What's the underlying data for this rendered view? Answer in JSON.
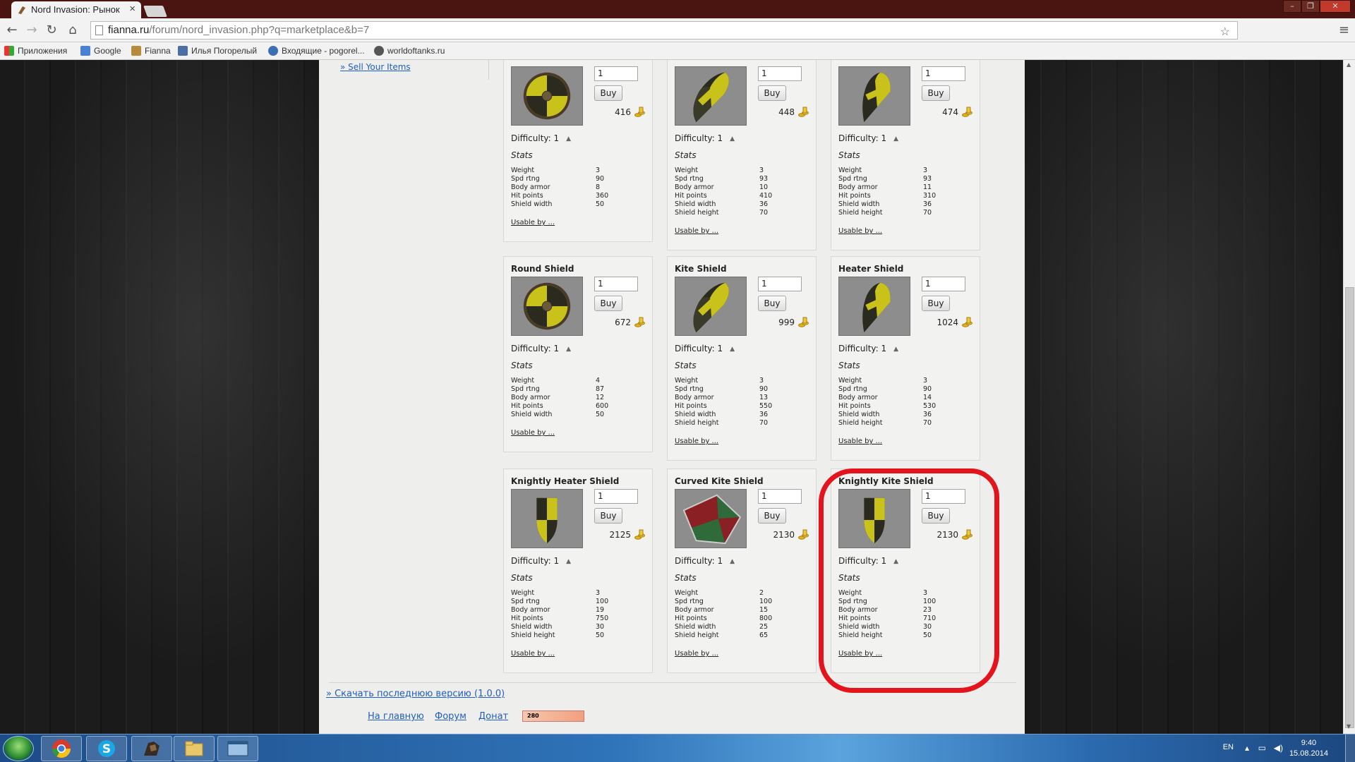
{
  "browser": {
    "tab_title": "Nord Invasion: Рынок",
    "tab_close": "×",
    "url_host": "fianna.ru",
    "url_path": "/forum/nord_invasion.php?q=marketplace&b=7",
    "bookmarks": [
      "Приложения",
      "Google",
      "Fianna",
      "Илья Погорелый",
      "Входящие - pogorel...",
      "worldoftanks.ru"
    ]
  },
  "sidebar": {
    "sell_link": "» Sell Your Items"
  },
  "labels": {
    "buy": "Buy",
    "difficulty": "Difficulty: 1",
    "stats": "Stats",
    "usable": "Usable by ...",
    "stat_names": [
      "Weight",
      "Spd rtng",
      "Body armor",
      "Hit points",
      "Shield width",
      "Shield height"
    ]
  },
  "items": [
    {
      "name": "",
      "qty": "1",
      "price": "416",
      "shape": "round",
      "stats": [
        "3",
        "90",
        "8",
        "360",
        "50"
      ]
    },
    {
      "name": "",
      "qty": "1",
      "price": "448",
      "shape": "kite",
      "stats": [
        "3",
        "93",
        "10",
        "410",
        "36",
        "70"
      ]
    },
    {
      "name": "",
      "qty": "1",
      "price": "474",
      "shape": "heater",
      "stats": [
        "3",
        "93",
        "11",
        "310",
        "36",
        "70"
      ]
    },
    {
      "name": "Round Shield",
      "qty": "1",
      "price": "672",
      "shape": "round",
      "stats": [
        "4",
        "87",
        "12",
        "600",
        "50"
      ]
    },
    {
      "name": "Kite Shield",
      "qty": "1",
      "price": "999",
      "shape": "kite",
      "stats": [
        "3",
        "90",
        "13",
        "550",
        "36",
        "70"
      ]
    },
    {
      "name": "Heater Shield",
      "qty": "1",
      "price": "1024",
      "shape": "heater",
      "stats": [
        "3",
        "90",
        "14",
        "530",
        "36",
        "70"
      ]
    },
    {
      "name": "Knightly Heater Shield",
      "qty": "1",
      "price": "2125",
      "shape": "knight",
      "stats": [
        "3",
        "100",
        "19",
        "750",
        "30",
        "50"
      ]
    },
    {
      "name": "Curved Kite Shield",
      "qty": "1",
      "price": "2130",
      "shape": "curved",
      "stats": [
        "2",
        "100",
        "15",
        "800",
        "25",
        "65"
      ]
    },
    {
      "name": "Knightly Kite Shield",
      "qty": "1",
      "price": "2130",
      "shape": "knight",
      "stats": [
        "3",
        "100",
        "23",
        "710",
        "30",
        "50"
      ]
    }
  ],
  "footer": {
    "download_link": "» Скачать последнюю версию (1.0.0)",
    "home": "На главную",
    "forum": "Форум",
    "donate": "Донат",
    "counter": "280"
  },
  "taskbar": {
    "lang": "EN",
    "time": "9:40",
    "date": "15.08.2014"
  },
  "colors": {
    "link": "#1f5fbf",
    "highlight": "#e4141c",
    "shield_yellow": "#c9c21a",
    "shield_dark": "#2a2a1e"
  }
}
